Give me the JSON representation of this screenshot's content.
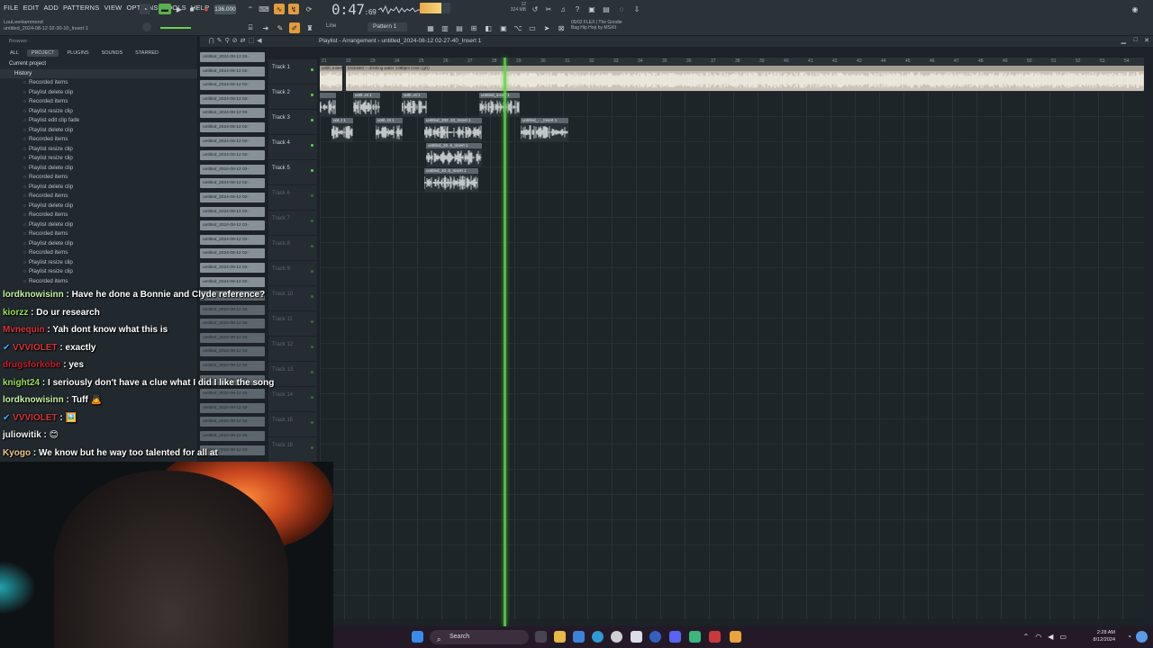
{
  "menu": [
    "FILE",
    "EDIT",
    "ADD",
    "PATTERNS",
    "VIEW",
    "OPTIONS",
    "TOOLS",
    "HELP"
  ],
  "project": {
    "user": "LouLeeHammond",
    "file": "untitled_2024-08-12 02-30-10_Insert 1"
  },
  "transport": {
    "tempo": "136.000",
    "time_main": "0:47",
    "time_sub": ":69",
    "pattern": "Pattern 1",
    "cpu": "12",
    "ram": "324 MB",
    "snap_mode": "Line"
  },
  "news": {
    "line1": "05/02  FLEX | The Goodie",
    "line2": "Bag Hip Hop by MSXII"
  },
  "browser": {
    "title": "Browser",
    "tabs": [
      "ALL",
      "PROJECT",
      "PLUGINS",
      "SOUNDS",
      "STARRED"
    ],
    "tree_top": "Current project",
    "history": "History",
    "items": [
      "Recorded items",
      "Playlist delete clip",
      "Recorded items",
      "Playlist resize clip",
      "Playlist edit clip fade",
      "Playlist delete clip",
      "Recorded items",
      "Playlist resize clip",
      "Playlist resize clip",
      "Playlist delete clip",
      "Recorded items",
      "Playlist delete clip",
      "Recorded items",
      "Playlist delete clip",
      "Recorded items",
      "Playlist delete clip",
      "Recorded items",
      "Playlist delete clip",
      "Recorded items",
      "Playlist resize clip",
      "Playlist resize clip",
      "Recorded items"
    ]
  },
  "clip_label": "untitled_2024-08-12 02-",
  "playlist": {
    "title": "Playlist - Arrangement  ›  untitled_2024-08-12 02-27-40_Insert 1",
    "tracks": [
      "Track 1",
      "Track 2",
      "Track 3",
      "Track 4",
      "Track 5",
      "Track 6",
      "Track 7",
      "Track 8",
      "Track 9",
      "Track 10",
      "Track 11",
      "Track 12",
      "Track 13",
      "Track 14",
      "Track 15",
      "Track 16"
    ],
    "bars": [
      "21",
      "22",
      "23",
      "24",
      "25",
      "26",
      "27",
      "28",
      "29",
      "30",
      "31",
      "32",
      "33",
      "34",
      "35",
      "36",
      "37",
      "38",
      "39",
      "40",
      "41",
      "42",
      "43",
      "44",
      "45",
      "46",
      "47",
      "48",
      "49",
      "50",
      "51",
      "52",
      "53",
      "54"
    ]
  },
  "clips": [
    {
      "label": "untitl..Insert",
      "style": "light"
    },
    {
      "label": "bricksterr – drinking water 136bpm Cmin (gls)",
      "style": "light"
    },
    {
      "label": "",
      "style": "dark"
    },
    {
      "label": "untit..nt 1",
      "style": "dark"
    },
    {
      "label": "untit..nt 1",
      "style": "dark"
    },
    {
      "label": "untitled_insert 1",
      "style": "dark"
    },
    {
      "label": "unt..t 1",
      "style": "dark"
    },
    {
      "label": "untit..nt 1",
      "style": "dark"
    },
    {
      "label": "untitled_202..33_Insert 1",
      "style": "dark"
    },
    {
      "label": "untitled_..._Insert 1",
      "style": "dark"
    },
    {
      "label": "untitled_20..6_Insert 1",
      "style": "dark"
    },
    {
      "label": "untitled_20..5_Insert 1",
      "style": "dark"
    }
  ],
  "chat": [
    {
      "user": "lordknowisinn",
      "cls": "u-lord",
      "msg": ": Have he done a Bonnie and Clyde reference?"
    },
    {
      "user": "kiorzz",
      "cls": "u-kio",
      "msg": ": Do ur research"
    },
    {
      "user": "Mvnequin",
      "cls": "u-mv",
      "msg": ": Yah dont know what this is"
    },
    {
      "user": "VVVIOLET",
      "cls": "u-vv",
      "msg": ": exactly",
      "badge": true
    },
    {
      "user": "drugsforkobe",
      "cls": "u-drug",
      "msg": ": yes"
    },
    {
      "user": "knight24",
      "cls": "u-knight",
      "msg": ": I seriously don't have a clue what I did I like the song"
    },
    {
      "user": "lordknowisinn",
      "cls": "u-lord",
      "msg": ": Tuff 🙇"
    },
    {
      "user": "VVVIOLET",
      "cls": "u-vv",
      "msg": ": 🖼️",
      "badge": true
    },
    {
      "user": "juliowitik",
      "cls": "u-jul",
      "msg": ": 😊"
    },
    {
      "user": "Kyogo",
      "cls": "u-kyo",
      "msg": ": We know but he way too talented for all at"
    }
  ],
  "taskbar": {
    "search": "Search",
    "time": "2:28 AM",
    "date": "8/12/2024"
  }
}
